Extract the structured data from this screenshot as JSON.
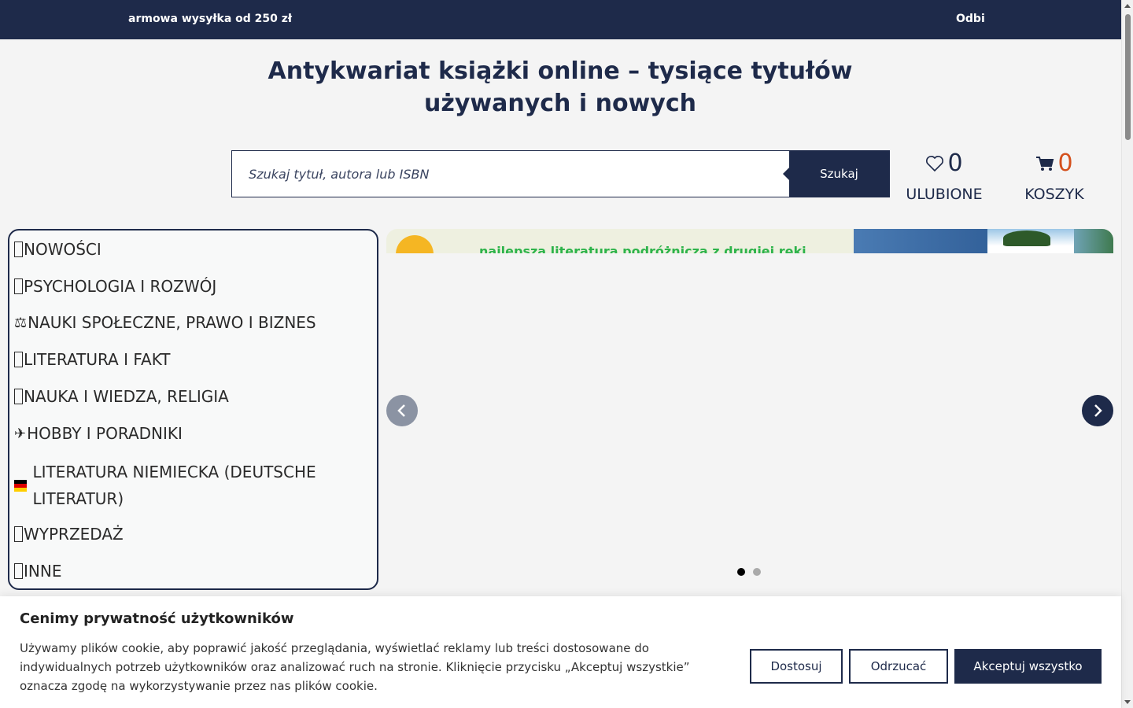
{
  "topbar": {
    "promo": "armowa wysyłka od 250 zł",
    "pickup_icon": "",
    "pickup": "Odbi"
  },
  "headline": "Antykwariat książki online – tysiące tytułów używanych i nowych",
  "search": {
    "placeholder": " Szukaj tytuł, autora lub ISBN",
    "button": "Szukaj"
  },
  "favorites": {
    "count": "0",
    "label": "ULUBIONE",
    "icon": "heart-icon"
  },
  "cart": {
    "count": "0",
    "label": "KOSZYK",
    "icon": "cart-icon",
    "count_color": "#d4501c"
  },
  "categories": [
    {
      "label": "NOWOŚCI",
      "icon": "box"
    },
    {
      "label": "PSYCHOLOGIA I ROZWÓJ",
      "icon": "box"
    },
    {
      "label": "NAUKI SPOŁECZNE, PRAWO I BIZNES",
      "icon": "⚖"
    },
    {
      "label": "LITERATURA I FAKT",
      "icon": "box"
    },
    {
      "label": "NAUKA I WIEDZA, RELIGIA",
      "icon": "box"
    },
    {
      "label": "HOBBY I PORADNIKI",
      "icon": "✈"
    },
    {
      "label": "LITERATURA NIEMIECKA (DEUTSCHE LITERATUR)",
      "icon": "german-flag"
    },
    {
      "label": "WYPRZEDAŻ",
      "icon": "box"
    },
    {
      "label": "INNE",
      "icon": "box"
    }
  ],
  "slider": {
    "banner_text": "najlepsza literatura podróżnicza z drugiej ręki",
    "slide_count": 2,
    "active_slide": 1
  },
  "cookie": {
    "title": "Cenimy prywatność użytkowników",
    "text": "Używamy plików cookie, aby poprawić jakość przeglądania, wyświetlać reklamy lub treści dostosowane do indywidualnych potrzeb użytkowników oraz analizować ruch na stronie. Kliknięcie przycisku „Akceptuj wszystkie” oznacza zgodę na wykorzystywanie przez nas plików cookie.",
    "customize": "Dostosuj",
    "reject": "Odrzucać",
    "accept": "Akceptuj wszystko"
  },
  "colors": {
    "brand_navy": "#1e2a4a",
    "accent_orange": "#d4501c"
  }
}
